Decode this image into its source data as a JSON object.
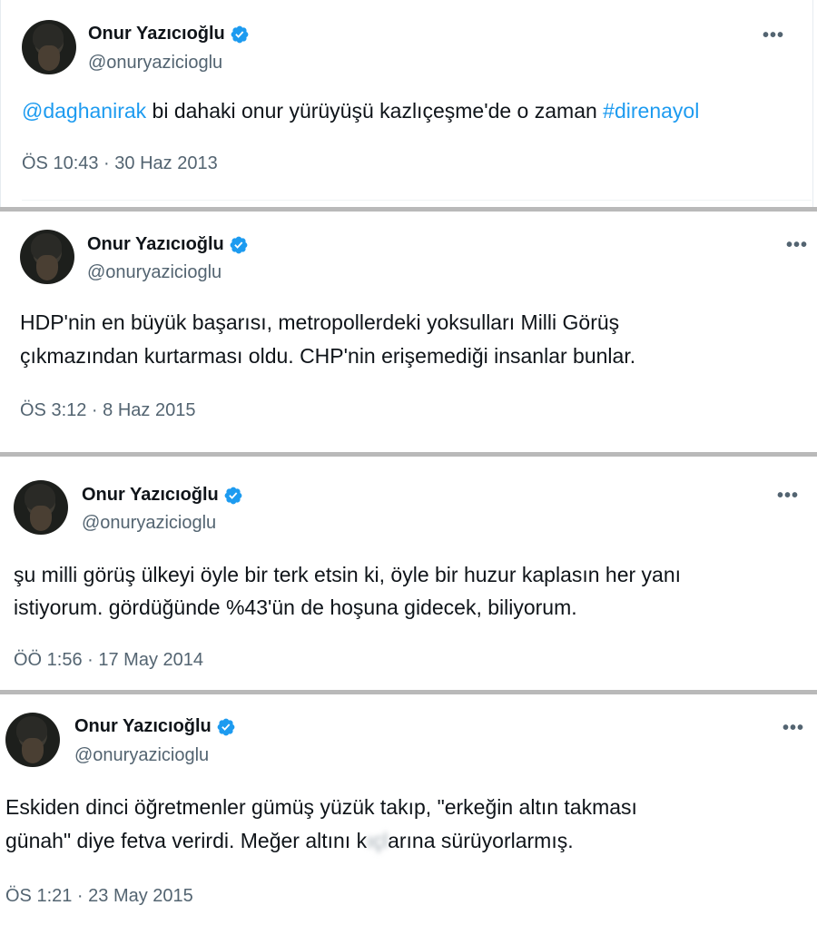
{
  "tweets": [
    {
      "author": "Onur Yazıcıoğlu",
      "handle": "@onuryazicioglu",
      "verified": true,
      "more_label": "•••",
      "text_parts": {
        "mention": "@daghanirak",
        "body": " bi dahaki onur yürüyüşü kazlıçeşme'de o zaman ",
        "hashtag": "#direnayol"
      },
      "timestamp": "ÖS 10:43 · 30 Haz 2013"
    },
    {
      "author": "Onur Yazıcıoğlu",
      "handle": "@onuryazicioglu",
      "verified": true,
      "more_label": "•••",
      "lines": [
        "HDP'nin en büyük başarısı, metropollerdeki yoksulları Milli Görüş",
        "çıkmazından kurtarması oldu. CHP'nin erişemediği insanlar bunlar."
      ],
      "timestamp": "ÖS 3:12 · 8 Haz 2015"
    },
    {
      "author": "Onur Yazıcıoğlu",
      "handle": "@onuryazicioglu",
      "verified": true,
      "more_label": "•••",
      "lines": [
        "şu milli görüş ülkeyi öyle bir terk etsin ki, öyle bir huzur kaplasın her yanı",
        "istiyorum. gördüğünde %43'ün de hoşuna gidecek, biliyorum."
      ],
      "timestamp": "ÖÖ 1:56 · 17 May 2014"
    },
    {
      "author": "Onur Yazıcıoğlu",
      "handle": "@onuryazicioglu",
      "verified": true,
      "more_label": "•••",
      "line1": "Eskiden dinci öğretmenler gümüş yüzük takıp, \"erkeğin altın takması",
      "line2_parts": {
        "before": "günah\" diye fetva verirdi. Meğer altını k",
        "blurred": "ıçl",
        "after": "arına sürüyorlarmış."
      },
      "timestamp": "ÖS 1:21 · 23 May 2015"
    }
  ],
  "colors": {
    "link": "#1d9bf0",
    "verified": "#1d9bf0",
    "secondary": "#536471",
    "separator": "#b9b9b9"
  },
  "icons": {
    "verified": "verified-badge-icon",
    "more": "more-dots-icon"
  }
}
